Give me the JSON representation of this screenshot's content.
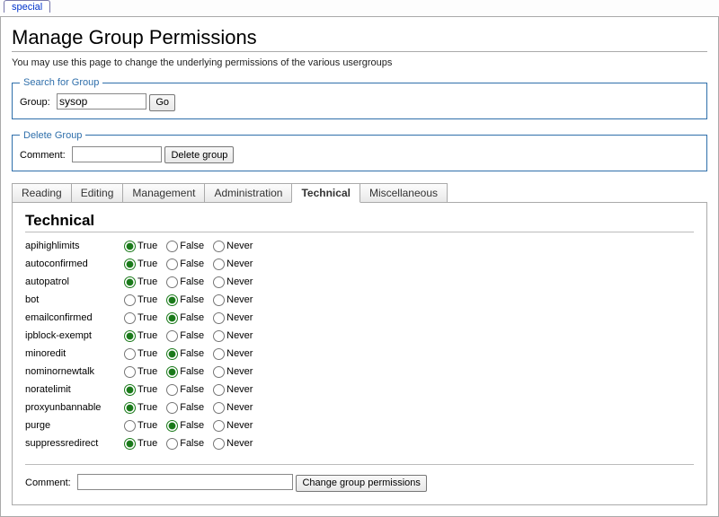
{
  "topTab": "special",
  "pageTitle": "Manage Group Permissions",
  "subtext": "You may use this page to change the underlying permissions of the various usergroups",
  "search": {
    "legend": "Search for Group",
    "label": "Group:",
    "value": "sysop",
    "button": "Go"
  },
  "delete": {
    "legend": "Delete Group",
    "label": "Comment:",
    "value": "",
    "button": "Delete group"
  },
  "tabs": [
    "Reading",
    "Editing",
    "Management",
    "Administration",
    "Technical",
    "Miscellaneous"
  ],
  "activeTab": "Technical",
  "panelHeading": "Technical",
  "options": {
    "t": "True",
    "f": "False",
    "n": "Never"
  },
  "permissions": [
    {
      "name": "apihighlimits",
      "value": "t"
    },
    {
      "name": "autoconfirmed",
      "value": "t"
    },
    {
      "name": "autopatrol",
      "value": "t"
    },
    {
      "name": "bot",
      "value": "f"
    },
    {
      "name": "emailconfirmed",
      "value": "f"
    },
    {
      "name": "ipblock-exempt",
      "value": "t"
    },
    {
      "name": "minoredit",
      "value": "f"
    },
    {
      "name": "nominornewtalk",
      "value": "f"
    },
    {
      "name": "noratelimit",
      "value": "t"
    },
    {
      "name": "proxyunbannable",
      "value": "t"
    },
    {
      "name": "purge",
      "value": "f"
    },
    {
      "name": "suppressredirect",
      "value": "t"
    }
  ],
  "change": {
    "label": "Comment:",
    "value": "",
    "button": "Change group permissions"
  }
}
